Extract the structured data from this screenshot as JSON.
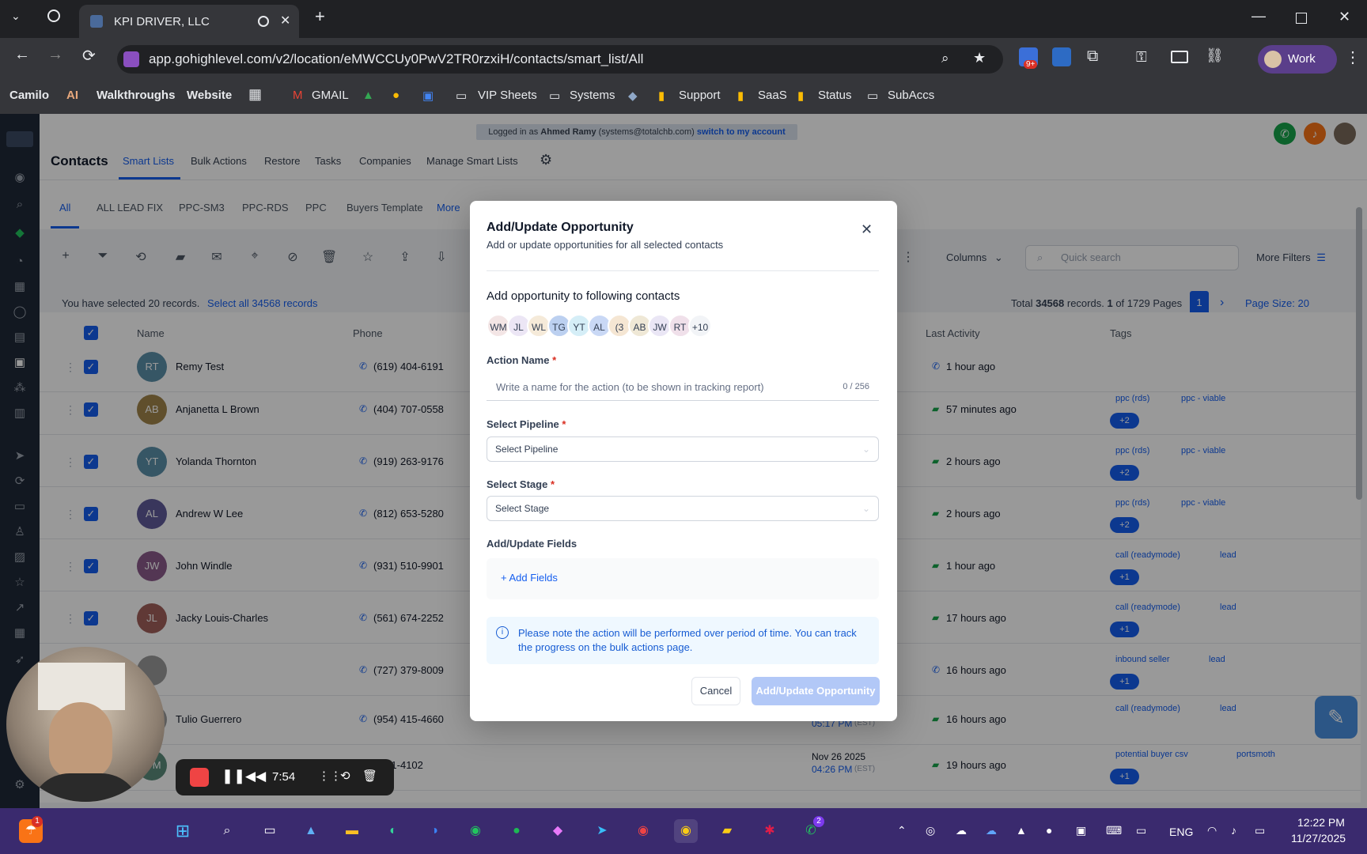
{
  "browser": {
    "tab_title": "KPI DRIVER, LLC",
    "url": "app.gohighlevel.com/v2/location/eMWCCUy0PwV2TR0rzxiH/contacts/smart_list/All",
    "profile": "Work",
    "badge": "9+",
    "bookmarks": [
      "Camilo",
      "AI",
      "Walkthroughs",
      "Website",
      "GMAIL",
      "VIP Sheets",
      "Systems",
      "Support",
      "SaaS",
      "Status",
      "SubAccs"
    ]
  },
  "app": {
    "banner_prefix": "Logged in as",
    "banner_user": "Ahmed Ramy",
    "banner_email": "(systems@totalchb.com)",
    "banner_switch": "switch to my account",
    "title": "Contacts",
    "nav": [
      "Smart Lists",
      "Bulk Actions",
      "Restore",
      "Tasks",
      "Companies",
      "Manage Smart Lists"
    ],
    "lists": [
      "All",
      "ALL LEAD FIX",
      "PPC-SM3",
      "PPC-RDS",
      "PPC",
      "Buyers Template",
      "More"
    ],
    "selected_prefix": "You have selected 20 records.",
    "select_all": "Select all 34568 records",
    "columns_label": "Columns",
    "search_placeholder": "Quick search",
    "more_filters": "More Filters",
    "pagination": {
      "total_label": "Total",
      "total": "34568",
      "records_label": "records.",
      "page": "1",
      "of_label": "of 1729 Pages",
      "page_size": "Page Size: 20"
    },
    "headers": {
      "name": "Name",
      "phone": "Phone",
      "last_activity": "Last Activity",
      "tags": "Tags"
    },
    "rows": [
      {
        "initials": "RT",
        "name": "Remy Test",
        "phone": "(619) 404-6191",
        "activity": "1 hour ago",
        "color": "#5b8fa8",
        "tags": [],
        "more": ""
      },
      {
        "initials": "AB",
        "name": "Anjanetta L Brown",
        "phone": "(404) 707-0558",
        "activity": "57 minutes ago",
        "color": "#a0844a",
        "tags": [
          "ppc (rds)",
          "ppc - viable"
        ],
        "more": "+2"
      },
      {
        "initials": "YT",
        "name": "Yolanda Thornton",
        "phone": "(919) 263-9176",
        "activity": "2 hours ago",
        "color": "#5b8fa8",
        "tags": [
          "ppc (rds)",
          "ppc - viable"
        ],
        "more": "+2"
      },
      {
        "initials": "AL",
        "name": "Andrew W Lee",
        "phone": "(812) 653-5280",
        "activity": "2 hours ago",
        "color": "#5f5a9a",
        "tags": [
          "ppc (rds)",
          "ppc - viable"
        ],
        "more": "+2"
      },
      {
        "initials": "JW",
        "name": "John Windle",
        "phone": "(931) 510-9901",
        "activity": "1 hour ago",
        "color": "#8a5a8a",
        "tags": [
          "call (readymode)",
          "lead"
        ],
        "more": "+1"
      },
      {
        "initials": "JL",
        "name": "Jacky Louis-Charles",
        "phone": "(561) 674-2252",
        "activity": "17 hours ago",
        "color": "#a0605a",
        "tags": [
          "call (readymode)",
          "lead"
        ],
        "more": "+1"
      },
      {
        "initials": "",
        "name": "",
        "phone": "(727) 379-8009",
        "activity": "16 hours ago",
        "color": "#9a9a9a",
        "tags": [
          "inbound seller",
          "lead"
        ],
        "more": "+1"
      },
      {
        "initials": "",
        "name": "Tulio Guerrero",
        "phone": "(954) 415-4660",
        "activity": "16 hours ago",
        "color": "#9a9a9a",
        "tags": [
          "call (readymode)",
          "lead"
        ],
        "more": "",
        "date": "Nov 26 2025",
        "time": "05:17 PM",
        "tz": "(EST)"
      },
      {
        "initials": "WM",
        "name": "",
        "phone": ") 821-4102",
        "activity": "19 hours ago",
        "color": "#5a8a7a",
        "tags": [
          "potential buyer csv",
          "portsmoth"
        ],
        "more": "+1",
        "date": "Nov 26 2025",
        "time": "04:26 PM",
        "tz": "(EST)"
      }
    ]
  },
  "modal": {
    "title": "Add/Update Opportunity",
    "subtitle": "Add or update opportunities for all selected contacts",
    "contacts_heading": "Add opportunity to following contacts",
    "chips": [
      "WM",
      "JL",
      "WL",
      "TG",
      "YT",
      "AL",
      "(3",
      "AB",
      "JW",
      "RT",
      "+10"
    ],
    "chip_colors": [
      "#f3e5e5",
      "#ece6f5",
      "#f5ead9",
      "#bcd0f0",
      "#d5eef7",
      "#c9d8f5",
      "#f5e6d3",
      "#efe8d6",
      "#eae6f5",
      "#f0e0ea",
      "#f2f4f7"
    ],
    "action_label": "Action Name",
    "required": "*",
    "action_placeholder": "Write a name for the action (to be shown in tracking report)",
    "char_count": "0 / 256",
    "pipeline_label": "Select Pipeline",
    "pipeline_placeholder": "Select Pipeline",
    "stage_label": "Select Stage",
    "stage_placeholder": "Select Stage",
    "fields_label": "Add/Update Fields",
    "add_fields": "+ Add Fields",
    "note": "Please note the action will be performed over period of time. You can track the progress on the bulk actions page.",
    "cancel": "Cancel",
    "submit": "Add/Update Opportunity"
  },
  "recorder": {
    "time": "7:54"
  },
  "taskbar": {
    "lang": "ENG",
    "time": "12:22 PM",
    "date": "11/27/2025",
    "badge1": "1",
    "badge2": "2"
  }
}
